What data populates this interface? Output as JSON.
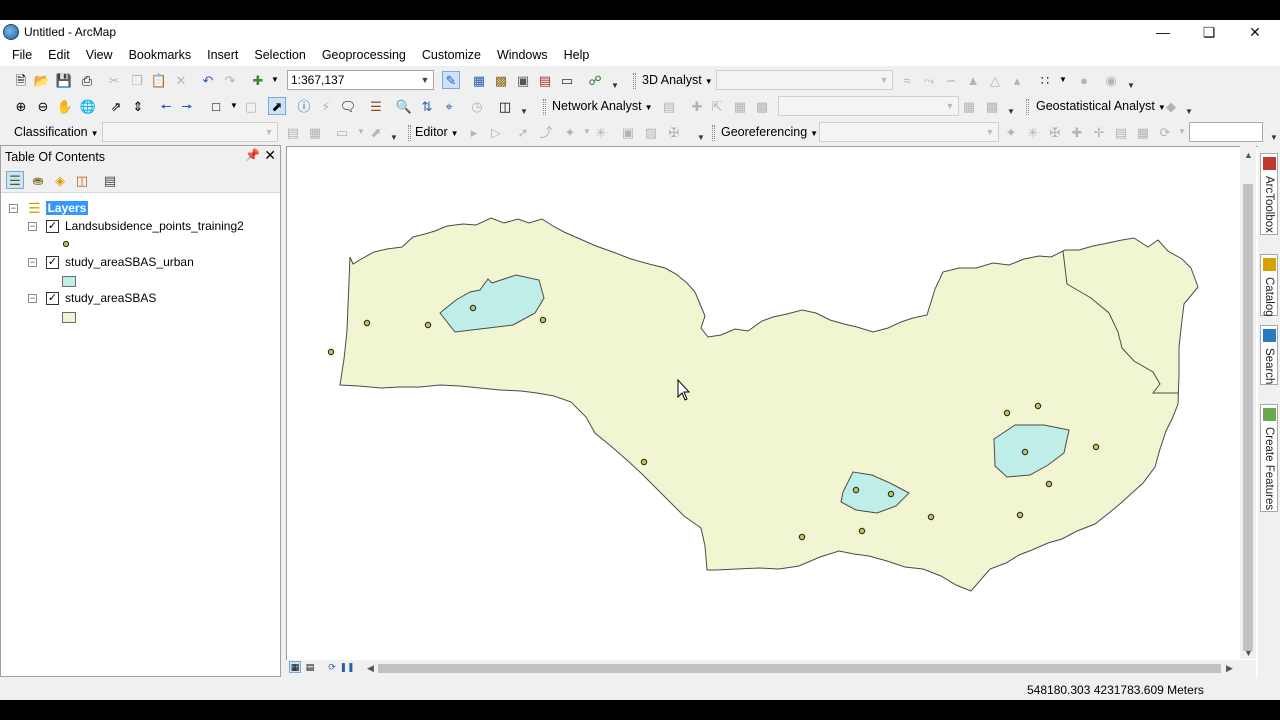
{
  "window": {
    "title": "Untitled - ArcMap",
    "controls": [
      "minimize",
      "restore",
      "close"
    ]
  },
  "menu": [
    "File",
    "Edit",
    "View",
    "Bookmarks",
    "Insert",
    "Selection",
    "Geoprocessing",
    "Customize",
    "Windows",
    "Help"
  ],
  "toolbar": {
    "scale": "1:367,137",
    "analyst_3d": "3D Analyst",
    "network_analyst": "Network Analyst",
    "geostatistical_analyst": "Geostatistical Analyst",
    "classification": "Classification",
    "editor": "Editor",
    "georeferencing": "Georeferencing"
  },
  "toc": {
    "title": "Table Of Contents",
    "root_label": "Layers",
    "layers": [
      {
        "name": "Landsubsidence_points_training2",
        "checked": true,
        "symbol": "point",
        "color": "#bcc45a"
      },
      {
        "name": "study_areaSBAS_urban",
        "checked": true,
        "symbol": "polygon",
        "color": "#bfeee9"
      },
      {
        "name": "study_areaSBAS",
        "checked": true,
        "symbol": "polygon",
        "color": "#f2f5d2"
      }
    ]
  },
  "dock_tabs": [
    "ArcToolbox",
    "Catalog",
    "Search",
    "Create Features"
  ],
  "status": {
    "coordinates": "548180.303  4231783.609 Meters"
  },
  "colors": {
    "study_area_fill": "#f2f5d2",
    "urban_fill": "#bfeee9",
    "point_fill": "#bcc45a",
    "selection_blue": "#3399ff"
  }
}
